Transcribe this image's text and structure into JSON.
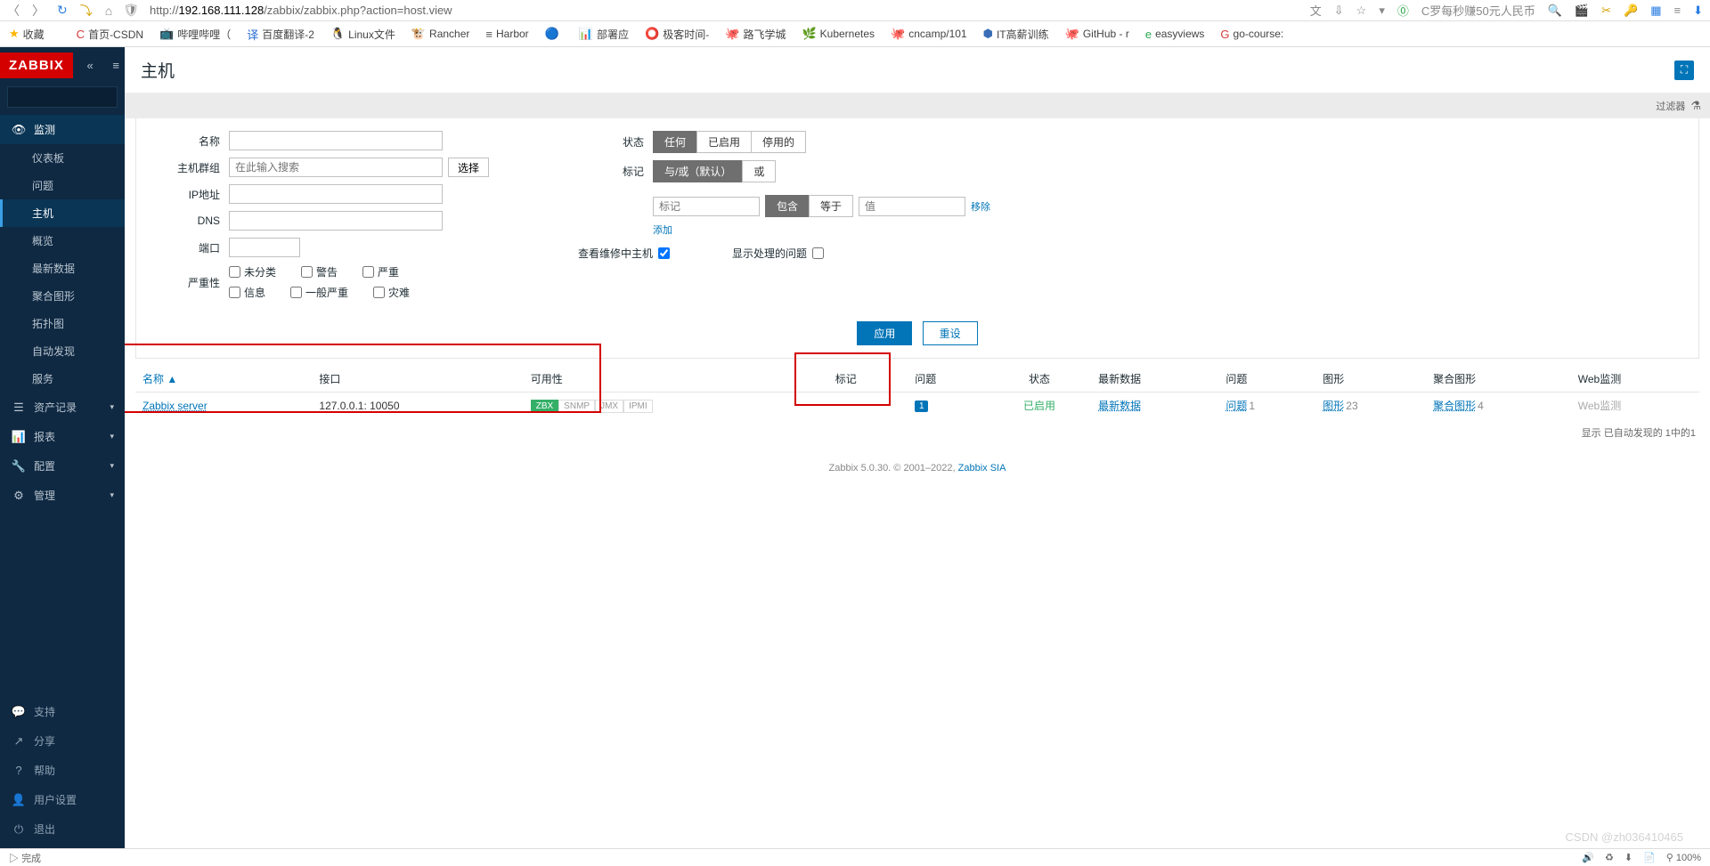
{
  "browser": {
    "url_prefix": "http://",
    "url_bold": "192.168.111.128",
    "url_rest": "/zabbix/zabbix.php?action=host.view",
    "right_hint": "C罗每秒赚50元人民币"
  },
  "bookmarks": {
    "fav": "收藏",
    "items": [
      {
        "icon": "C",
        "label": "首页-CSDN",
        "color": "#d43c3c"
      },
      {
        "icon": "📺",
        "label": "哔哩哔哩（",
        "color": "#3aa0da"
      },
      {
        "icon": "译",
        "label": "百度翻译-2",
        "color": "#2b6cd4"
      },
      {
        "icon": "🐧",
        "label": "Linux文件",
        "color": "#333"
      },
      {
        "icon": "🐮",
        "label": "Rancher",
        "color": "#2a7de1"
      },
      {
        "icon": "≡",
        "label": "Harbor",
        "color": "#555"
      },
      {
        "icon": "🔵",
        "label": "",
        "color": "#2a7de1"
      },
      {
        "icon": "📊",
        "label": "部署应",
        "color": "#d43c3c"
      },
      {
        "icon": "⭕",
        "label": "极客时间-",
        "color": "#d43c3c"
      },
      {
        "icon": "🐙",
        "label": "路飞学城",
        "color": "#000"
      },
      {
        "icon": "🌿",
        "label": "Kubernetes",
        "color": "#34af67"
      },
      {
        "icon": "🐙",
        "label": "cncamp/101",
        "color": "#000"
      },
      {
        "icon": "⬢",
        "label": "IT高薪训练",
        "color": "#3a6fb7"
      },
      {
        "icon": "🐙",
        "label": "GitHub - r",
        "color": "#000"
      },
      {
        "icon": "e",
        "label": "easyviews",
        "color": "#2fa84f"
      },
      {
        "icon": "G",
        "label": "go-course:",
        "color": "#d43c3c"
      }
    ]
  },
  "sidebar": {
    "logo": "ZABBIX",
    "sections": {
      "monitor": {
        "label": "监测",
        "children": [
          "仪表板",
          "问题",
          "主机",
          "概览",
          "最新数据",
          "聚合图形",
          "拓扑图",
          "自动发现",
          "服务"
        ],
        "active": "主机"
      },
      "inventory": {
        "label": "资产记录"
      },
      "reports": {
        "label": "报表"
      },
      "config": {
        "label": "配置"
      },
      "admin": {
        "label": "管理"
      }
    },
    "bottom": [
      "支持",
      "分享",
      "帮助",
      "用户设置",
      "退出"
    ]
  },
  "page": {
    "title": "主机",
    "filter_label": "过滤器"
  },
  "filter": {
    "name": "名称",
    "hostgroup": "主机群组",
    "hostgroup_ph": "在此输入搜索",
    "select": "选择",
    "ip": "IP地址",
    "dns": "DNS",
    "port": "端口",
    "severity": "严重性",
    "sev_items": [
      "未分类",
      "警告",
      "严重",
      "信息",
      "一般严重",
      "灾难"
    ],
    "status": "状态",
    "status_items": [
      "任何",
      "已启用",
      "停用的"
    ],
    "tags": "标记",
    "tags_items": [
      "与/或（默认）",
      "或"
    ],
    "tag_ph_name": "标记",
    "tag_contains": "包含",
    "tag_equals": "等于",
    "tag_ph_val": "值",
    "remove": "移除",
    "add": "添加",
    "show_maint": "查看维修中主机",
    "show_prob": "显示处理的问题",
    "apply": "应用",
    "reset": "重设"
  },
  "table": {
    "headers": {
      "name": "名称",
      "iface": "接口",
      "avail": "可用性",
      "tags": "标记",
      "problems": "问题",
      "status": "状态",
      "latest": "最新数据",
      "prob": "问题",
      "graphs": "图形",
      "screens": "聚合图形",
      "web": "Web监测"
    },
    "sort_indicator": "▲",
    "row": {
      "name": "Zabbix server",
      "iface": "127.0.0.1: 10050",
      "avail": [
        "ZBX",
        "SNMP",
        "JMX",
        "IPMI"
      ],
      "avail_on": "ZBX",
      "problems_badge": "1",
      "status": "已启用",
      "latest": "最新数据",
      "prob": "问题",
      "prob_n": "1",
      "graphs": "图形",
      "graphs_n": "23",
      "screens": "聚合图形",
      "screens_n": "4",
      "web": "Web监测"
    },
    "summary": "显示 已自动发现的 1中的1"
  },
  "footer": {
    "text": "Zabbix 5.0.30. © 2001–2022, ",
    "link": "Zabbix SIA"
  },
  "statusbar": {
    "done": "完成",
    "right": "CSDN @zh036410465"
  },
  "watermark": "CSDN @zh036410465"
}
